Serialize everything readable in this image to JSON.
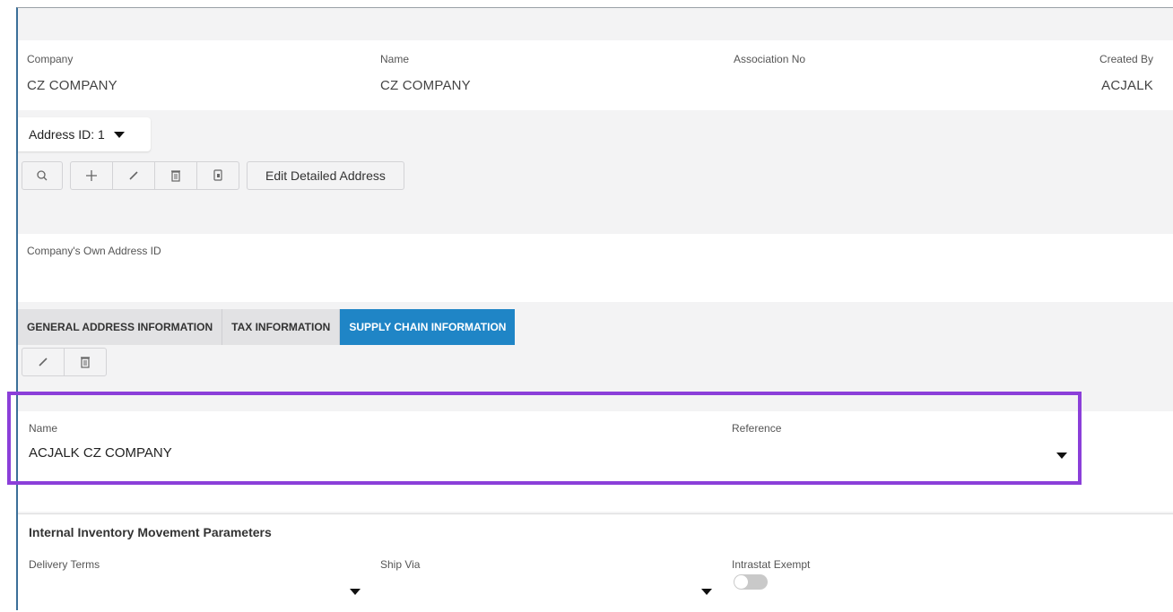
{
  "header": {
    "company": {
      "label": "Company",
      "value": "CZ COMPANY"
    },
    "name": {
      "label": "Name",
      "value": "CZ COMPANY"
    },
    "association": {
      "label": "Association No",
      "value": ""
    },
    "created_by": {
      "label": "Created By",
      "value": "ACJALK"
    }
  },
  "address": {
    "selector_label": "Address ID: 1",
    "edit_detailed_label": "Edit Detailed Address",
    "own_address_label": "Company's Own Address ID",
    "own_address_value": ""
  },
  "tabs": [
    {
      "label": "GENERAL ADDRESS INFORMATION"
    },
    {
      "label": "TAX INFORMATION"
    },
    {
      "label": "SUPPLY CHAIN INFORMATION"
    }
  ],
  "supply": {
    "name_label": "Name",
    "name_value": "ACJALK CZ COMPANY",
    "reference_label": "Reference",
    "reference_value": ""
  },
  "internal": {
    "section_title": "Internal Inventory Movement Parameters",
    "delivery_terms_label": "Delivery Terms",
    "ship_via_label": "Ship Via",
    "intrastat_label": "Intrastat Exempt",
    "intrastat_on": false
  },
  "colors": {
    "active_tab": "#1f85c6",
    "highlight": "#8b3fd9",
    "frame_left": "#3b6f99"
  }
}
